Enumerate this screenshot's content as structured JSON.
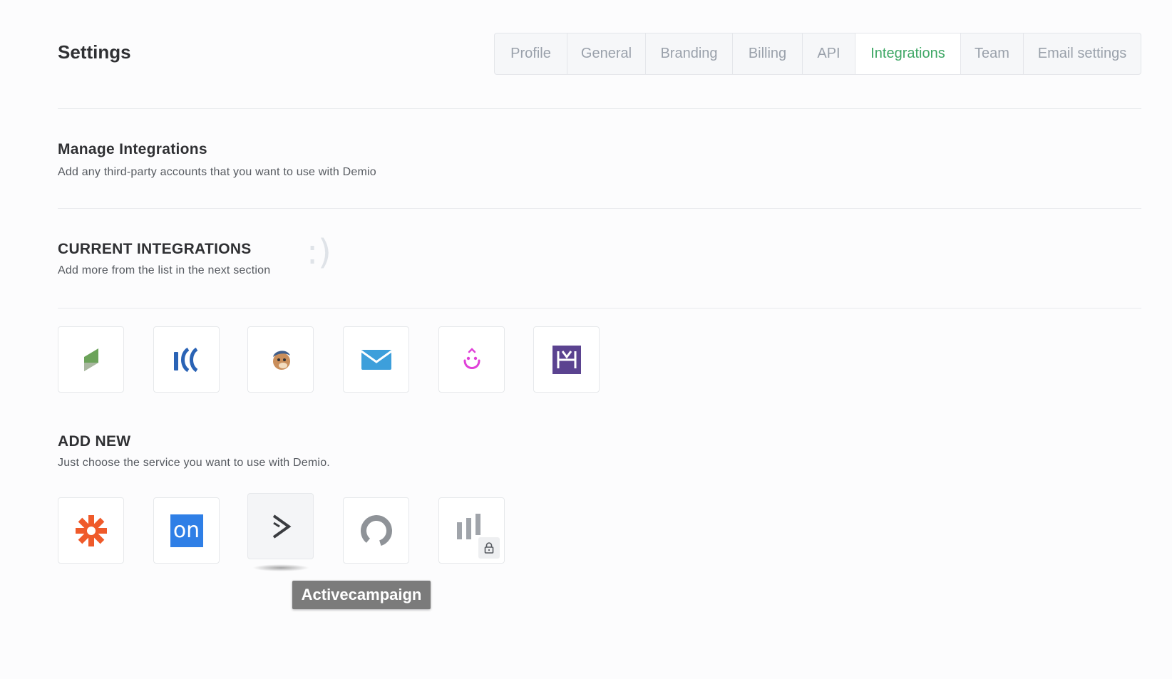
{
  "page": {
    "title": "Settings"
  },
  "tabs": [
    {
      "label": "Profile",
      "active": false
    },
    {
      "label": "General",
      "active": false
    },
    {
      "label": "Branding",
      "active": false
    },
    {
      "label": "Billing",
      "active": false
    },
    {
      "label": "API",
      "active": false
    },
    {
      "label": "Integrations",
      "active": true
    },
    {
      "label": "Team",
      "active": false
    },
    {
      "label": "Email settings",
      "active": false
    }
  ],
  "manage": {
    "title": "Manage Integrations",
    "subtitle": "Add any third-party accounts that you want to use with Demio"
  },
  "current": {
    "title": "CURRENT INTEGRATIONS",
    "subtitle": "Add more from the list in the next section",
    "decoration": ":)",
    "items": [
      {
        "icon": "green-flag-logo-icon"
      },
      {
        "icon": "blue-waves-logo-icon"
      },
      {
        "icon": "mailchimp-logo-icon"
      },
      {
        "icon": "envelope-logo-icon"
      },
      {
        "icon": "smiling-face-logo-icon"
      },
      {
        "icon": "purple-h-logo-icon"
      }
    ]
  },
  "add_new": {
    "title": "ADD NEW",
    "subtitle": "Just choose the service you want to use with Demio.",
    "items": [
      {
        "icon": "zapier-asterisk-icon",
        "locked": false
      },
      {
        "icon": "ontraport-on-icon",
        "on_text": "on",
        "locked": false
      },
      {
        "icon": "activecampaign-chevron-icon",
        "locked": false
      },
      {
        "icon": "circular-arc-logo-icon",
        "locked": false
      },
      {
        "icon": "bars-logo-icon",
        "locked": true
      }
    ],
    "tooltip": "Activecampaign"
  },
  "colors": {
    "accent": "#3ea765",
    "zapier": "#ef5a2a",
    "ontraport": "#2f7fe6",
    "envelope": "#3d9fdb",
    "pink": "#e040d8",
    "purple": "#5b4390",
    "flag_green": "#6ca35a"
  }
}
